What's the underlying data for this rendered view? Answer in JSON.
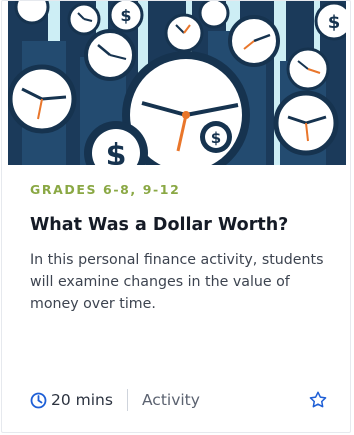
{
  "card": {
    "image_description_icon": "clocks-and-dollar-coins-illustration",
    "grades": "GRADES 6-8, 9-12",
    "title": "What Was a Dollar Worth?",
    "description": "In this personal finance activity, students will examine changes in the value of money over time.",
    "duration": "20 mins",
    "resource_type": "Activity",
    "clock_icon": "clock-icon",
    "favorite_icon": "star-outline-icon"
  },
  "colors": {
    "grade_accent": "#8aa844",
    "title": "#151b26",
    "icon_blue": "#1e5fd6",
    "illustration_navy": "#16334f",
    "illustration_sky": "#cdeef5",
    "clock_hand_orange": "#e9762b"
  }
}
